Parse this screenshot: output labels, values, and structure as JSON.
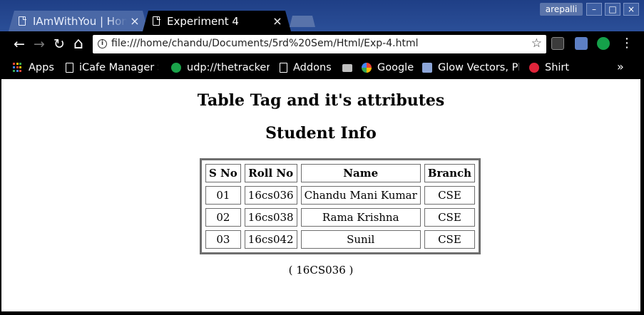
{
  "browser": {
    "tabs": [
      {
        "title": "IAmWithYou | Home",
        "close": "×",
        "active": false
      },
      {
        "title": "Experiment 4",
        "close": "×",
        "active": true
      }
    ],
    "user": "arepalli",
    "window_buttons": {
      "minimize": "–",
      "maximize": "□",
      "close": "×"
    },
    "nav": {
      "back": "←",
      "forward": "→",
      "reload": "↻",
      "home": "⌂"
    },
    "address_bar": {
      "url": "file:///home/chandu/Documents/5rd%20Sem/Html/Exp-4.html",
      "info": "i",
      "bookmark_star": "☆"
    },
    "menu": "⋮",
    "bookmarks": [
      {
        "label": "Apps",
        "icon": "apps-grid-icon"
      },
      {
        "label": "iCafe Manager Se",
        "icon": "page-icon"
      },
      {
        "label": "udp://thetracker",
        "icon": "star-badge-icon"
      },
      {
        "label": "Addons",
        "icon": "page-icon"
      },
      {
        "label": "",
        "icon": "folder-icon"
      },
      {
        "label": "Google",
        "icon": "google-icon"
      },
      {
        "label": "Glow Vectors, Ph",
        "icon": "image-icon"
      },
      {
        "label": "Shirt",
        "icon": "shop-icon"
      }
    ],
    "bookmarks_more": "»",
    "colors": {
      "titlebar": "#2b4f98",
      "active_tab": "#000000",
      "inactive_tab": "#4a68a6"
    }
  },
  "page": {
    "heading1": "Table Tag and it's attributes",
    "heading2": "Student Info",
    "table": {
      "headers": [
        "S No",
        "Roll No",
        "Name",
        "Branch"
      ],
      "rows": [
        [
          "01",
          "16cs036",
          "Chandu Mani Kumar",
          "CSE"
        ],
        [
          "02",
          "16cs038",
          "Rama Krishna",
          "CSE"
        ],
        [
          "03",
          "16cs042",
          "Sunil",
          "CSE"
        ]
      ]
    },
    "footer": "( 16CS036 )"
  }
}
